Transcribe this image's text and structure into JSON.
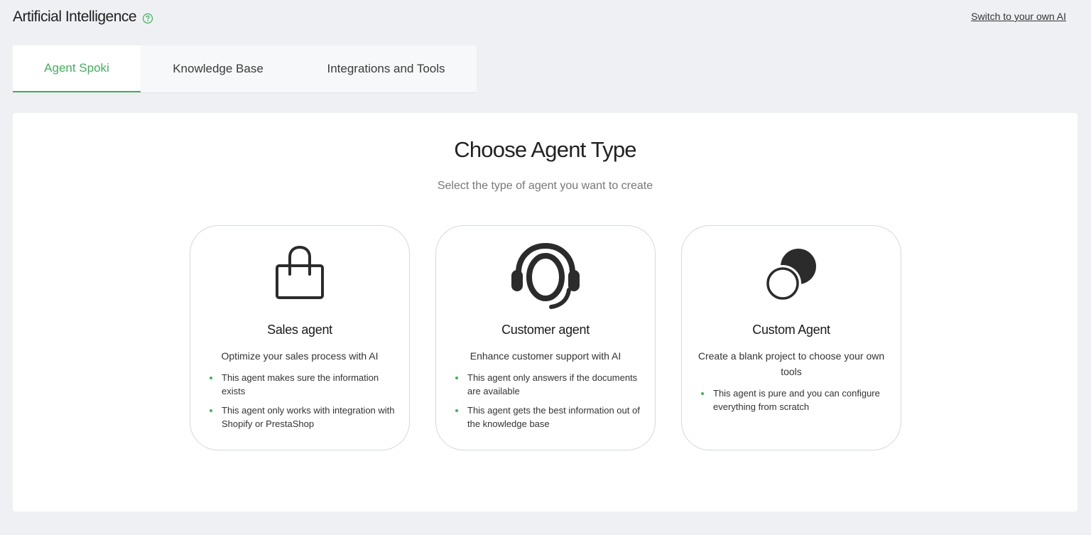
{
  "header": {
    "title": "Artificial Intelligence",
    "switch_link": "Switch to your own AI"
  },
  "tabs": [
    {
      "label": "Agent Spoki",
      "active": true
    },
    {
      "label": "Knowledge Base",
      "active": false
    },
    {
      "label": "Integrations and Tools",
      "active": false
    }
  ],
  "panel": {
    "title": "Choose Agent Type",
    "subtitle": "Select the type of agent you want to create"
  },
  "cards": [
    {
      "icon": "shopping-bag-icon",
      "title": "Sales agent",
      "description": "Optimize your sales process with AI",
      "bullets": [
        "This agent makes sure the information exists",
        "This agent only works with integration with Shopify or PrestaShop"
      ]
    },
    {
      "icon": "headset-icon",
      "title": "Customer agent",
      "description": "Enhance customer support with AI",
      "bullets": [
        "This agent only answers if the documents are available",
        "This agent gets the best information out of the knowledge base"
      ]
    },
    {
      "icon": "circles-icon",
      "title": "Custom Agent",
      "description": "Create a blank project to choose your own tools",
      "bullets": [
        "This agent is pure and you can configure everything from scratch"
      ]
    }
  ],
  "colors": {
    "accent": "#3db35a",
    "background": "#eef0f4",
    "panel": "#ffffff"
  }
}
